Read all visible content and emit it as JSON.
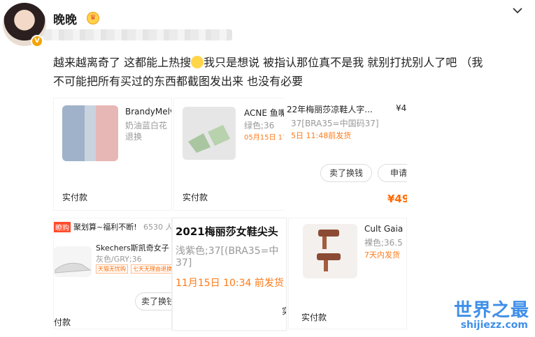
{
  "post": {
    "username": "晚晚",
    "text_line1": "越来越离奇了 这都能上热搜",
    "text_line1b": "我只是想说 被指认那位真不是我 就别打扰别人了吧 （我",
    "text_line2": "不可能把所有买过的东西都截图发出来 也没有必要"
  },
  "panels": {
    "p1": {
      "title": "BrandyMelv",
      "sub1": "奶油蓝白花",
      "sub2": "退换",
      "footer": "实付款"
    },
    "p2": {
      "title": "ACNE 鱼嘴",
      "variant": "绿色;36",
      "date": "05月15日 17:",
      "footer": "实付款"
    },
    "p3": {
      "title": "22年梅丽莎凉鞋人字...",
      "price_head": "¥4",
      "variant": "37[BRA35=中国码37]",
      "date": "5日 11:48前发货",
      "btn1": "卖了换钱",
      "btn2": "申请",
      "price": "¥49"
    },
    "p4": {
      "promo_badge": "瞭购",
      "promo": "聚划算~福利不断!",
      "promo_count": "6530 人",
      "title": "Skechers斯凯奇女子",
      "variant": "灰色/GRY;36",
      "tag1": "天猫无忧购",
      "tag2": "七天无理由退换",
      "btn": "卖了换钱",
      "footer": "付款"
    },
    "p5": {
      "title": "2021梅丽莎女鞋尖头",
      "variant": "浅紫色;37[(BRA35=中",
      "variant2": "37]",
      "date": "11月15日 10:34 前发货",
      "side": "实"
    },
    "p6": {
      "title": "Cult Gaia",
      "variant": "裸色;36.5",
      "date": "7天内发货",
      "footer": "实付款"
    }
  },
  "watermark": {
    "line1": "世界之最",
    "line2": "shijiezz.com"
  },
  "colors": {
    "orange": "#ff7a1a",
    "blue": "#3f8fe8"
  }
}
